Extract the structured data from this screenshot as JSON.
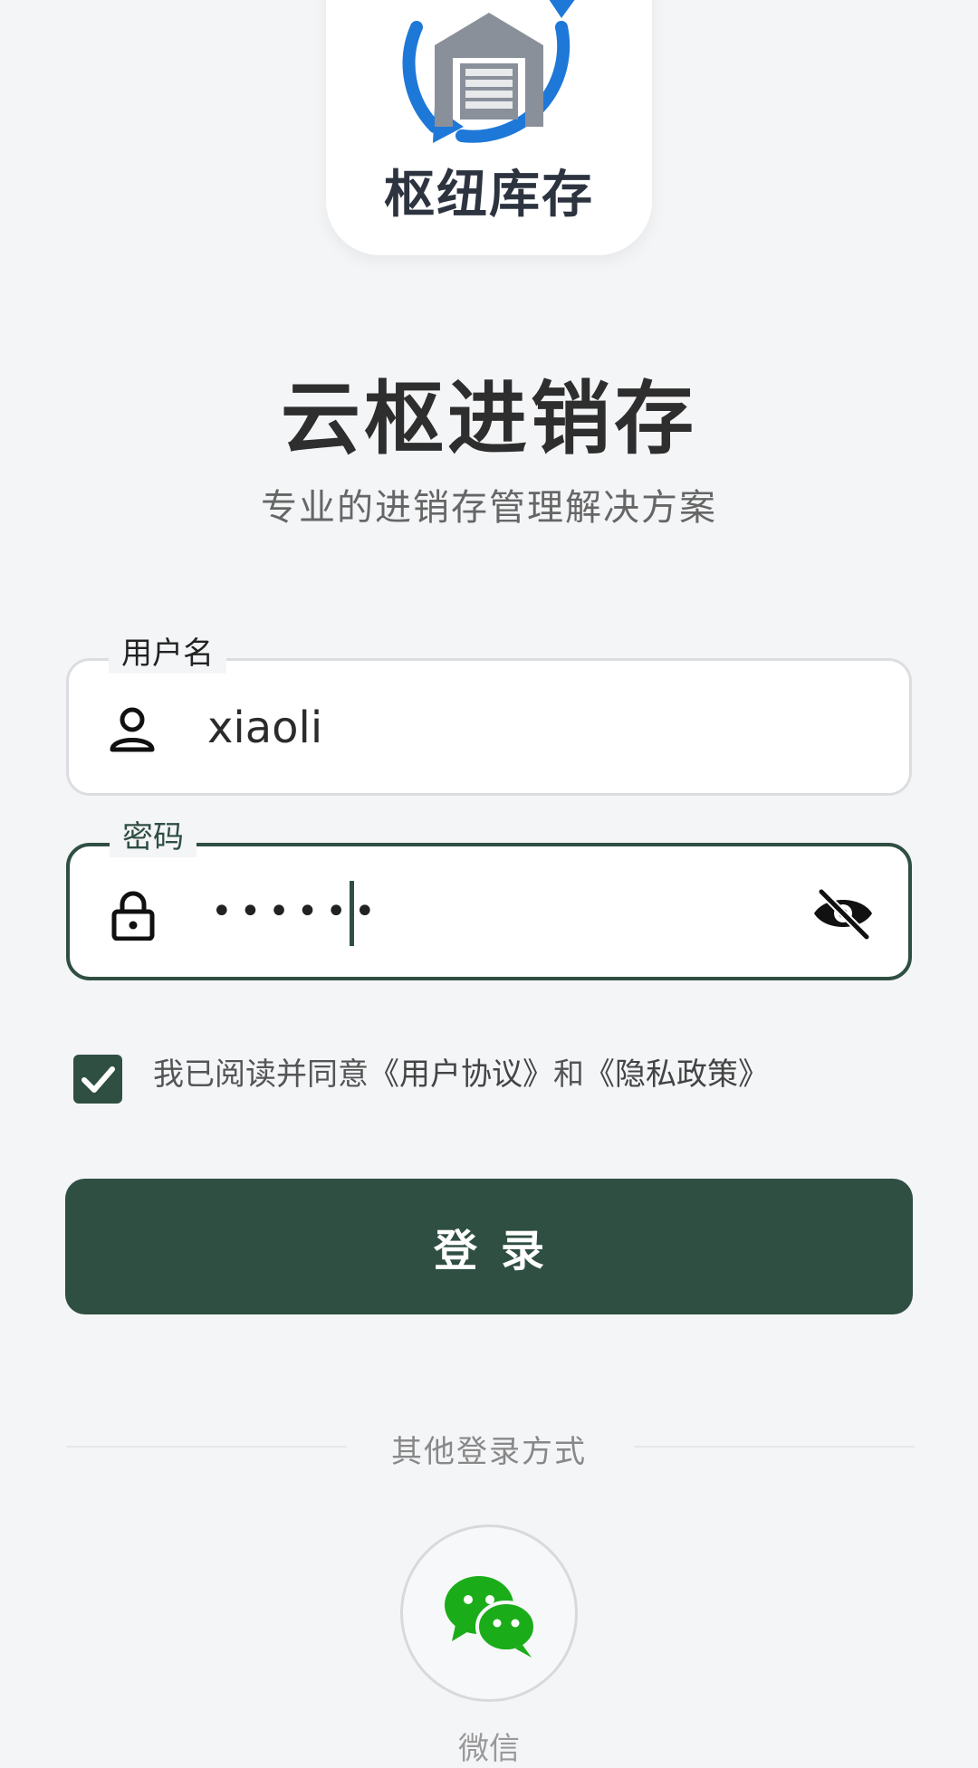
{
  "logo": {
    "text": "枢纽库存",
    "icon": "warehouse-refresh-icon"
  },
  "header": {
    "title": "云枢进销存",
    "subtitle": "专业的进销存管理解决方案"
  },
  "form": {
    "username": {
      "label": "用户名",
      "value": "xiaoli",
      "icon": "user-icon"
    },
    "password": {
      "label": "密码",
      "masked_value": "••••••",
      "icon": "lock-icon",
      "toggle_icon": "eye-off-icon",
      "focused": true
    }
  },
  "agreement": {
    "checked": true,
    "prefix": "我已阅读并同意",
    "user_agreement": "《用户协议》",
    "conjunction": "和",
    "privacy_policy": "《隐私政策》"
  },
  "login_button": {
    "label": "登录"
  },
  "other_login": {
    "label": "其他登录方式",
    "wechat_label": "微信",
    "wechat_icon": "wechat-icon"
  },
  "colors": {
    "primary": "#2f4f43",
    "background": "#f4f5f7",
    "wechat": "#1aad19",
    "logo_blue": "#1e78d8",
    "logo_gray": "#8a909a"
  }
}
